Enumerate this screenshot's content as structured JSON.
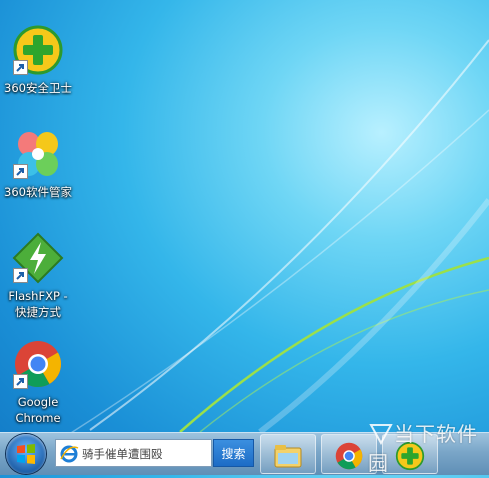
{
  "desktop": {
    "icons": [
      {
        "label": "360安全卫士",
        "icon": "360-safe-icon"
      },
      {
        "label": "360软件管家",
        "icon": "360-software-manager-icon"
      },
      {
        "label": "FlashFXP -\n快捷方式",
        "icon": "flashfxp-icon"
      },
      {
        "label": "Google\nChrome",
        "icon": "chrome-icon"
      }
    ]
  },
  "taskbar": {
    "search": {
      "placeholder": "骑手催单遭围殴",
      "button_label": "搜索",
      "icon": "ie-icon"
    },
    "pinned": [
      {
        "name": "file-explorer",
        "icon": "folder-icon"
      },
      {
        "name": "google-chrome",
        "icon": "chrome-icon"
      },
      {
        "name": "360-safe",
        "icon": "360-safe-icon"
      }
    ]
  },
  "watermark": {
    "text": "当下软件园"
  },
  "colors": {
    "desktop": "#34b6ea",
    "taskbar": "#7aa6c8",
    "search_button": "#1c6cc6"
  }
}
